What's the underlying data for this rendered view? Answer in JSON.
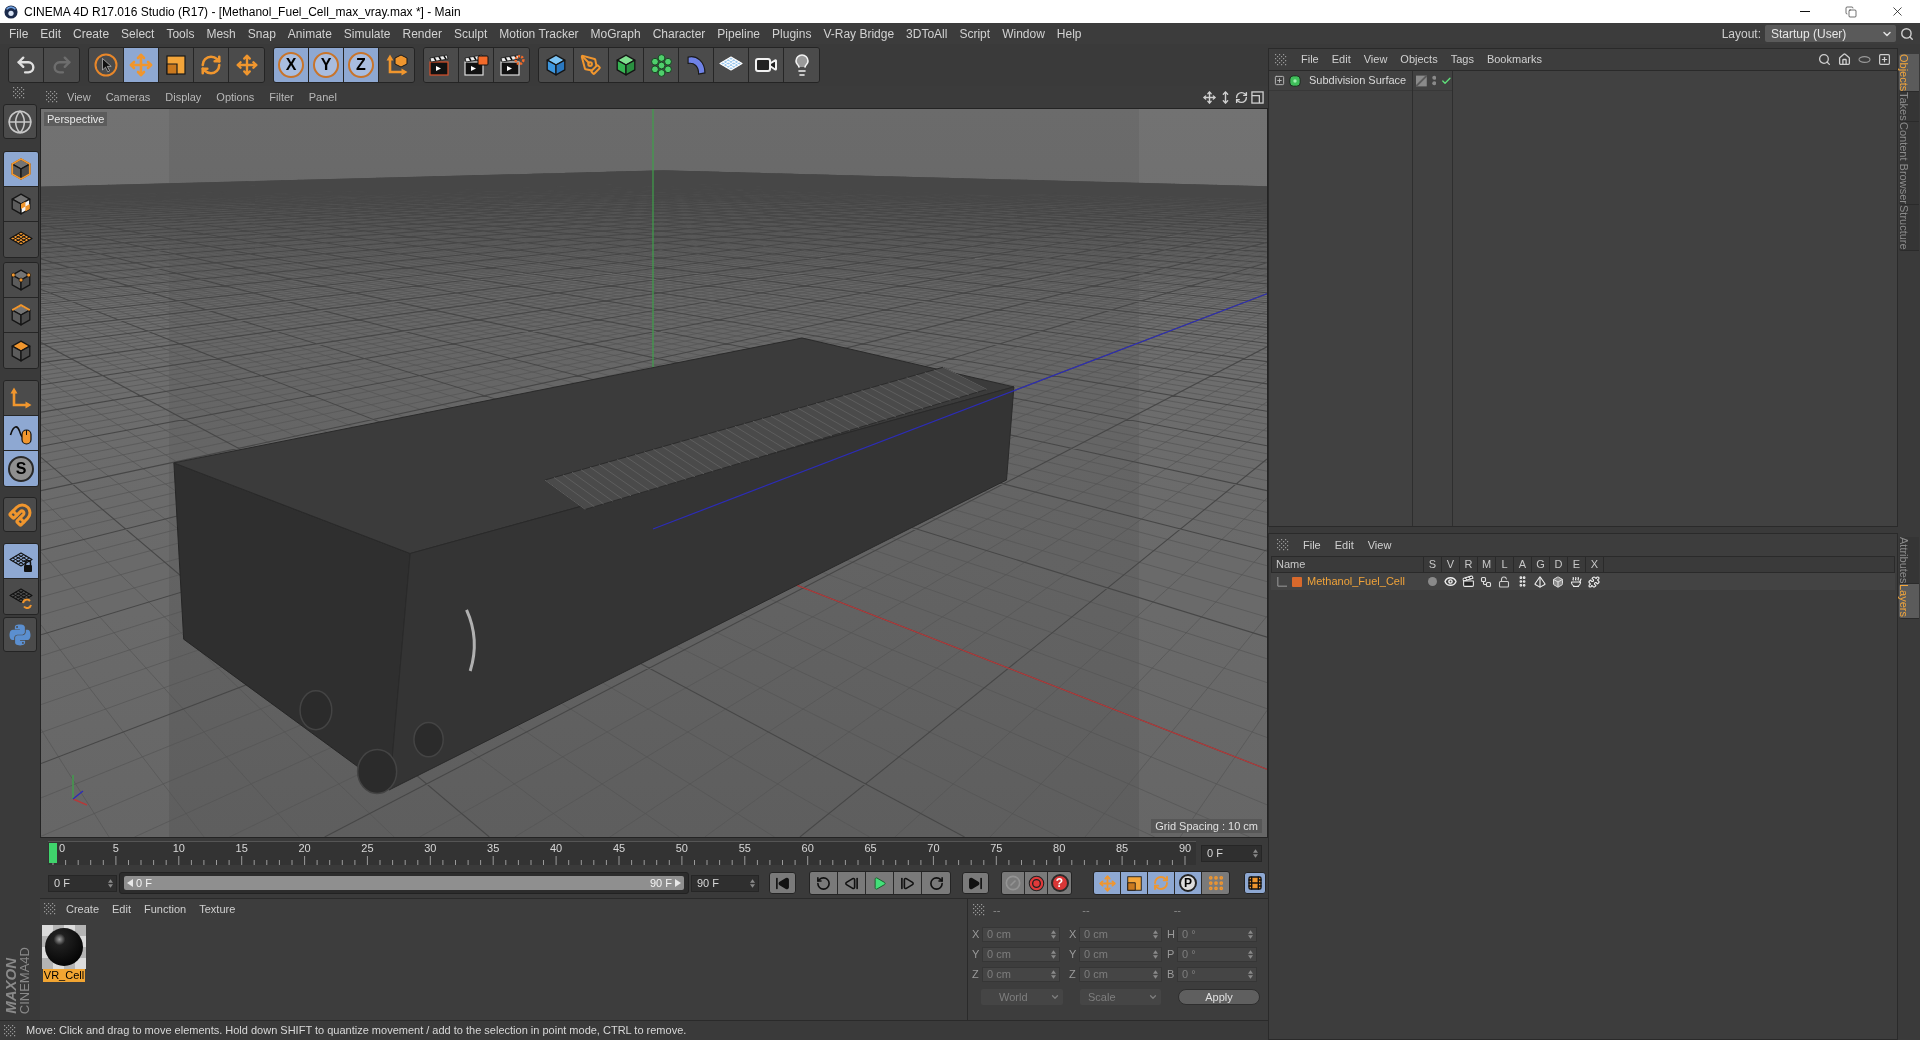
{
  "window": {
    "title": "CINEMA 4D R17.016 Studio (R17) - [Methanol_Fuel_Cell_max_vray.max *] - Main"
  },
  "menu_bar": {
    "items": [
      "File",
      "Edit",
      "Create",
      "Select",
      "Tools",
      "Mesh",
      "Snap",
      "Animate",
      "Simulate",
      "Render",
      "Sculpt",
      "Motion Tracker",
      "MoGraph",
      "Character",
      "Pipeline",
      "Plugins",
      "V-Ray Bridge",
      "3DToAll",
      "Script",
      "Window",
      "Help"
    ],
    "layout_label": "Layout:",
    "layout_value": "Startup (User)"
  },
  "toolbar": {
    "groups": [
      {
        "items": [
          {
            "kind": "icon",
            "selected": false,
            "disabled": false
          },
          {
            "kind": "icon",
            "selected": false,
            "disabled": true
          }
        ]
      },
      {
        "items": [
          {
            "kind": "icon",
            "selected": false
          },
          {
            "kind": "icon",
            "selected": true
          },
          {
            "kind": "icon",
            "selected": false
          },
          {
            "kind": "icon",
            "selected": false
          },
          {
            "kind": "icon",
            "selected": false
          }
        ]
      },
      {
        "items": [
          {
            "kind": "letter",
            "label": "X",
            "selected": true
          },
          {
            "kind": "letter",
            "label": "Y",
            "selected": true
          },
          {
            "kind": "letter",
            "label": "Z",
            "selected": true
          },
          {
            "kind": "icon",
            "selected": false
          }
        ]
      },
      {
        "items": [
          {
            "kind": "icon",
            "selected": false
          },
          {
            "kind": "icon",
            "selected": false
          },
          {
            "kind": "icon",
            "selected": false
          }
        ]
      },
      {
        "items": [
          {
            "kind": "icon",
            "selected": false
          },
          {
            "kind": "icon",
            "selected": false
          },
          {
            "kind": "icon",
            "selected": false
          },
          {
            "kind": "icon",
            "selected": false
          },
          {
            "kind": "icon",
            "selected": false
          },
          {
            "kind": "icon",
            "selected": false
          },
          {
            "kind": "icon",
            "selected": false
          },
          {
            "kind": "icon",
            "selected": false
          }
        ]
      }
    ]
  },
  "tool_strip": {
    "groups": [
      {
        "items": [
          {
            "kind": "icon",
            "selected": false
          }
        ]
      },
      {
        "items": [
          {
            "kind": "icon",
            "selected": true
          },
          {
            "kind": "icon",
            "selected": false
          },
          {
            "kind": "icon",
            "selected": false
          }
        ]
      },
      {
        "items": [
          {
            "kind": "icon",
            "selected": false
          },
          {
            "kind": "icon",
            "selected": false
          },
          {
            "kind": "icon",
            "selected": false
          }
        ]
      },
      {
        "items": [
          {
            "kind": "icon",
            "selected": false
          },
          {
            "kind": "icon",
            "selected": true
          },
          {
            "kind": "letter",
            "label": "S",
            "selected": true
          }
        ]
      },
      {
        "items": [
          {
            "kind": "icon",
            "selected": false
          }
        ]
      },
      {
        "items": [
          {
            "kind": "icon",
            "selected": true
          },
          {
            "kind": "icon",
            "selected": false
          }
        ]
      },
      {
        "items": [
          {
            "kind": "icon",
            "selected": false
          }
        ]
      }
    ]
  },
  "viewport": {
    "menu": [
      "View",
      "Cameras",
      "Display",
      "Options",
      "Filter",
      "Panel"
    ],
    "camera": "Perspective",
    "grid_info": "Grid Spacing : 10 cm"
  },
  "timeline": {
    "ticks": [
      "0",
      "5",
      "10",
      "15",
      "20",
      "25",
      "30",
      "35",
      "40",
      "45",
      "50",
      "55",
      "60",
      "65",
      "70",
      "75",
      "80",
      "85",
      "90"
    ],
    "level": 0,
    "frame_field": "0 F"
  },
  "playback": {
    "start_field": "0 F",
    "range": {
      "start": "0 F",
      "end": "90 F",
      "level": 1
    },
    "end_field": "90 F",
    "groups": [
      {
        "items": [
          {
            "kind": "icon",
            "selected": false
          }
        ]
      },
      {
        "items": [
          {
            "kind": "icon",
            "selected": false
          },
          {
            "kind": "icon",
            "selected": false
          },
          {
            "kind": "icon",
            "selected": false
          },
          {
            "kind": "icon",
            "selected": false
          },
          {
            "kind": "icon",
            "selected": false
          }
        ]
      },
      {
        "items": [
          {
            "kind": "icon",
            "selected": false
          }
        ]
      },
      {
        "items": [
          {
            "kind": "icon",
            "selected": false,
            "disabled": true
          },
          {
            "kind": "icon",
            "selected": false,
            "disabled": false
          },
          {
            "kind": "alert",
            "label": "?",
            "selected": false,
            "disabled": false
          }
        ]
      },
      {
        "items": [
          {
            "kind": "icon",
            "selected": true
          },
          {
            "kind": "icon",
            "selected": true
          },
          {
            "kind": "icon",
            "selected": true
          },
          {
            "kind": "letter",
            "label": "P",
            "selected": true
          },
          {
            "kind": "icon",
            "selected": false
          }
        ]
      },
      {
        "items": [
          {
            "kind": "icon",
            "selected": true
          }
        ]
      }
    ]
  },
  "material_manager": {
    "menu": [
      "Create",
      "Edit",
      "Function",
      "Texture"
    ],
    "materials": [
      {
        "name": "VR_Cell",
        "selected": true
      }
    ]
  },
  "coordinates": {
    "headers": [
      "--",
      "--",
      "--"
    ],
    "rows": [
      {
        "cells": [
          {
            "label": "X",
            "value": "0 cm"
          },
          {
            "label": "X",
            "value": "0 cm"
          },
          {
            "label": "H",
            "value": "0 °"
          }
        ]
      },
      {
        "cells": [
          {
            "label": "Y",
            "value": "0 cm"
          },
          {
            "label": "Y",
            "value": "0 cm"
          },
          {
            "label": "P",
            "value": "0 °"
          }
        ]
      },
      {
        "cells": [
          {
            "label": "Z",
            "value": "0 cm"
          },
          {
            "label": "Z",
            "value": "0 cm"
          },
          {
            "label": "B",
            "value": "0 °"
          }
        ]
      }
    ],
    "mode": "World",
    "transform": "Scale",
    "apply": "Apply"
  },
  "brand": {
    "maker": "MAXON",
    "product": "CINEMA4D"
  },
  "status_bar": {
    "text": "Move: Click and drag to move elements. Hold down SHIFT to quantize movement / add to the selection in point mode, CTRL to remove."
  },
  "object_manager": {
    "menu": [
      "File",
      "Edit",
      "View",
      "Objects",
      "Tags",
      "Bookmarks"
    ],
    "objects": [
      {
        "name": "Subdivision Surface",
        "expanded": false,
        "enabled": true
      }
    ]
  },
  "layer_manager": {
    "menu": [
      "File",
      "Edit",
      "View"
    ],
    "columns": [
      "Name",
      "S",
      "V",
      "R",
      "M",
      "L",
      "A",
      "G",
      "D",
      "E",
      "X"
    ],
    "layers": [
      {
        "name": "Methanol_Fuel_Cell",
        "color": "#d8692c"
      }
    ]
  },
  "side_tabs": {
    "upper": [
      {
        "label": "Objects",
        "selected": true
      },
      {
        "label": "Takes",
        "selected": false
      },
      {
        "label": "Content Browser",
        "selected": false
      },
      {
        "label": "Structure",
        "selected": false
      }
    ],
    "lower": [
      {
        "label": "Attributes",
        "selected": false
      },
      {
        "label": "Layers",
        "selected": true
      }
    ]
  }
}
